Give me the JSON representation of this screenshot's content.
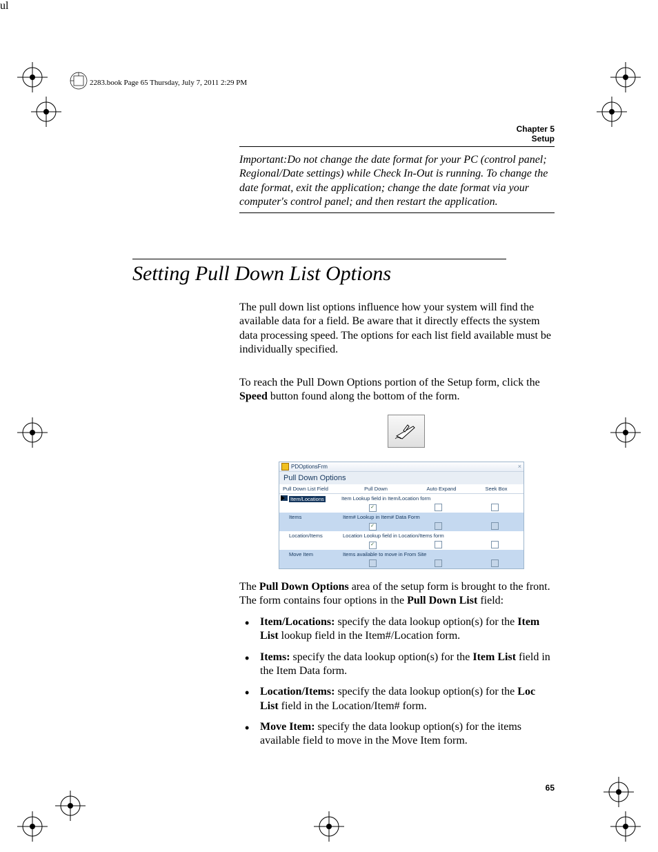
{
  "header": {
    "line": "2283.book  Page 65  Thursday, July 7, 2011  2:29 PM"
  },
  "chapter": {
    "line1": "Chapter 5",
    "line2": "Setup"
  },
  "important": "Important:Do not change the date format for your PC (control panel; Regional/Date settings) while Check In-Out is running. To change the date format, exit the application; change the date format via your computer's control panel; and then restart the application.",
  "section_title": "Setting Pull Down List Options",
  "body1": "The pull down list options influence how your system will find the available data for a field. Be aware that it directly effects the system data processing speed. The options for each list field available must be individually specified.",
  "body2_pre": "To reach the Pull Down Options portion of the Setup form, click the ",
  "body2_bold": "Speed",
  "body2_post": " button found along the bottom of the form.",
  "pd_form": {
    "window_title": "PDOptionsFrm",
    "header": "Pull Down Options",
    "col_field": "Pull Down List Field",
    "col_pd": "Pull Down",
    "col_ae": "Auto Expand",
    "col_sb": "Seek Box",
    "rows": [
      {
        "label": "Item/Locations",
        "desc": "Item Lookup field in Item/Location form",
        "pd": "checked",
        "ae": "empty",
        "sb": "empty"
      },
      {
        "label": "Items",
        "desc": "Item# Lookup in Item# Data Form",
        "pd": "checked",
        "ae": "mixed",
        "sb": "mixed"
      },
      {
        "label": "Location/Items",
        "desc": "Location Lookup field in Location/Items form",
        "pd": "checked",
        "ae": "empty",
        "sb": "empty"
      },
      {
        "label": "Move Item",
        "desc": "Items available to move in From Site",
        "pd": "mixed",
        "ae": "mixed",
        "sb": "mixed"
      }
    ]
  },
  "body3_pre": "The ",
  "body3_b1": "Pull Down Options",
  "body3_mid": " area of the setup form is brought to the front. The form contains four options in the ",
  "body3_b2": "Pull Down List",
  "body3_post": " field:",
  "bullets": [
    {
      "b": "Item/Locations:",
      "t1": " specify the data lookup option(s) for the ",
      "b2": "Item List",
      "t2": " lookup field in the Item#/Location form."
    },
    {
      "b": "Items:",
      "t1": " specify the data lookup option(s) for the ",
      "b2": "Item List",
      "t2": " field in the Item Data form."
    },
    {
      "b": "Location/Items:",
      "t1": " specify the data lookup option(s) for the ",
      "b2": "Loc List",
      "t2": " field in the Location/Item# form."
    },
    {
      "b": "Move Item:",
      "t1": " specify the data lookup option(s) for the items available field to move in the Move Item form.",
      "b2": "",
      "t2": ""
    }
  ],
  "page_number": "65"
}
